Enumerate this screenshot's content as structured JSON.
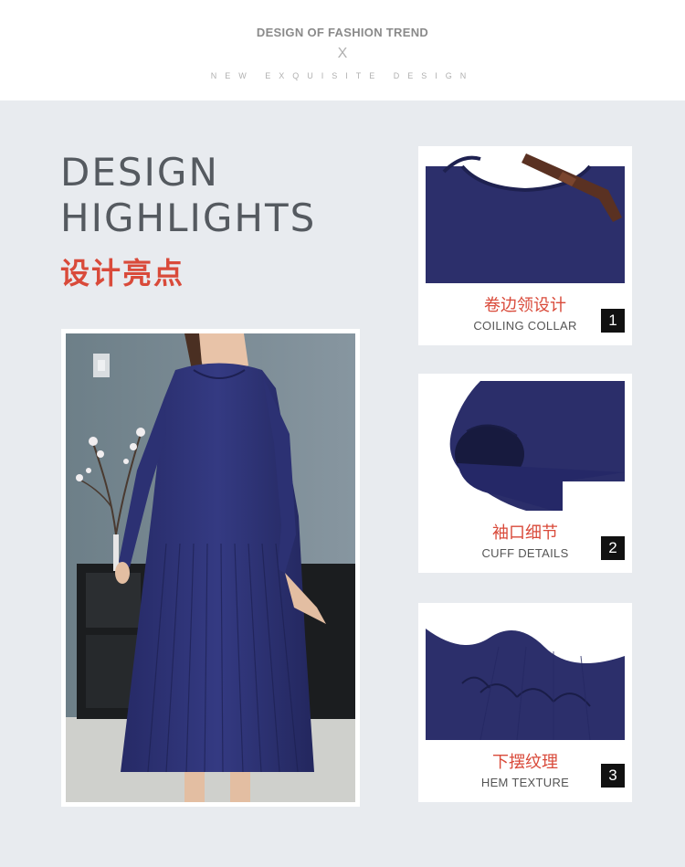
{
  "header": {
    "title": "DESIGN OF FASHION TREND",
    "separator": "X",
    "subtitle": "NEW EXQUISITE DESIGN"
  },
  "headline": {
    "line1": "DESIGN",
    "line2": "HIGHLIGHTS",
    "chinese": "设计亮点"
  },
  "features": [
    {
      "cn": "卷边领设计",
      "en": "COILING COLLAR",
      "number": "1"
    },
    {
      "cn": "袖口细节",
      "en": "CUFF DETAILS",
      "number": "2"
    },
    {
      "cn": "下摆纹理",
      "en": "HEM TEXTURE",
      "number": "3"
    }
  ],
  "colors": {
    "accent": "#d94a3a",
    "garment": "#2c2f6b",
    "background": "#e8ebef"
  }
}
